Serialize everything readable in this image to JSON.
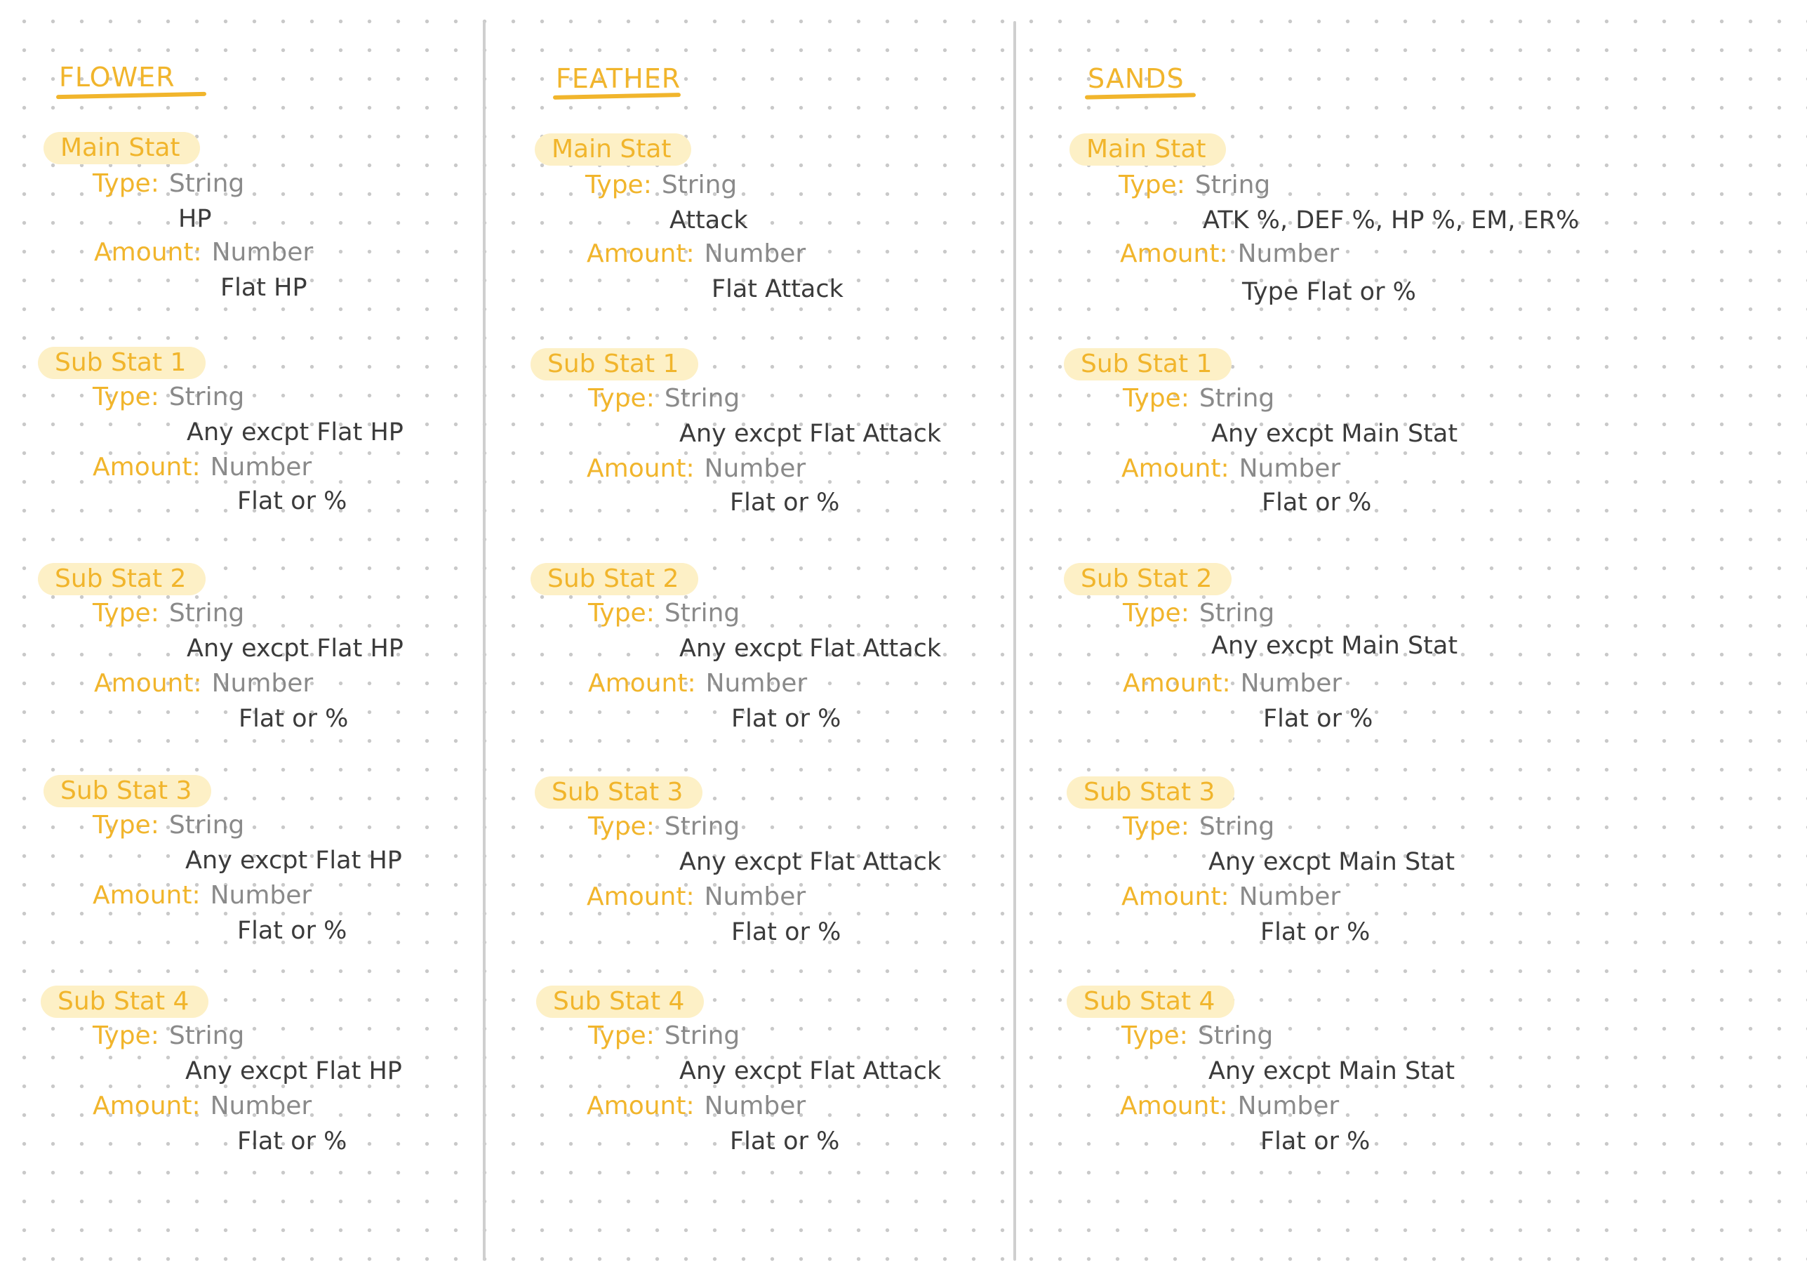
{
  "columns": [
    {
      "title": "FLOWER",
      "main_stat": {
        "label": "Main Stat",
        "type_key": "Type:",
        "type_value": "String",
        "type_detail": "HP",
        "amount_key": "Amount:",
        "amount_value": "Number",
        "amount_detail": "Flat HP"
      },
      "sub_stats": [
        {
          "label": "Sub Stat 1",
          "type_key": "Type:",
          "type_value": "String",
          "type_detail": "Any excpt Flat HP",
          "amount_key": "Amount:",
          "amount_value": "Number",
          "amount_detail": "Flat or %"
        },
        {
          "label": "Sub Stat 2",
          "type_key": "Type:",
          "type_value": "String",
          "type_detail": "Any excpt Flat HP",
          "amount_key": "Amount:",
          "amount_value": "Number",
          "amount_detail": "Flat or %"
        },
        {
          "label": "Sub Stat 3",
          "type_key": "Type:",
          "type_value": "String",
          "type_detail": "Any excpt Flat HP",
          "amount_key": "Amount:",
          "amount_value": "Number",
          "amount_detail": "Flat or %"
        },
        {
          "label": "Sub Stat 4",
          "type_key": "Type:",
          "type_value": "String",
          "type_detail": "Any excpt Flat HP",
          "amount_key": "Amount:",
          "amount_value": "Number",
          "amount_detail": "Flat or %"
        }
      ]
    },
    {
      "title": "FEATHER",
      "main_stat": {
        "label": "Main Stat",
        "type_key": "Type:",
        "type_value": "String",
        "type_detail": "Attack",
        "amount_key": "Amount:",
        "amount_value": "Number",
        "amount_detail": "Flat Attack"
      },
      "sub_stats": [
        {
          "label": "Sub Stat 1",
          "type_key": "Type:",
          "type_value": "String",
          "type_detail": "Any excpt Flat Attack",
          "amount_key": "Amount:",
          "amount_value": "Number",
          "amount_detail": "Flat or %"
        },
        {
          "label": "Sub Stat 2",
          "type_key": "Type:",
          "type_value": "String",
          "type_detail": "Any excpt Flat Attack",
          "amount_key": "Amount:",
          "amount_value": "Number",
          "amount_detail": "Flat or %"
        },
        {
          "label": "Sub Stat 3",
          "type_key": "Type:",
          "type_value": "String",
          "type_detail": "Any excpt Flat Attack",
          "amount_key": "Amount:",
          "amount_value": "Number",
          "amount_detail": "Flat or %"
        },
        {
          "label": "Sub Stat 4",
          "type_key": "Type:",
          "type_value": "String",
          "type_detail": "Any excpt Flat Attack",
          "amount_key": "Amount:",
          "amount_value": "Number",
          "amount_detail": "Flat or %"
        }
      ]
    },
    {
      "title": "SANDS",
      "main_stat": {
        "label": "Main Stat",
        "type_key": "Type:",
        "type_value": "String",
        "type_detail": "ATK %, DEF %, HP %, EM, ER%",
        "amount_key": "Amount:",
        "amount_value": "Number",
        "amount_detail": "Type Flat or %"
      },
      "sub_stats": [
        {
          "label": "Sub Stat 1",
          "type_key": "Type:",
          "type_value": "String",
          "type_detail": "Any excpt Main Stat",
          "amount_key": "Amount:",
          "amount_value": "Number",
          "amount_detail": "Flat or %"
        },
        {
          "label": "Sub Stat 2",
          "type_key": "Type:",
          "type_value": "String",
          "type_detail": "Any excpt Main Stat",
          "amount_key": "Amount:",
          "amount_value": "Number",
          "amount_detail": "Flat or %"
        },
        {
          "label": "Sub Stat 3",
          "type_key": "Type:",
          "type_value": "String",
          "type_detail": "Any excpt Main Stat",
          "amount_key": "Amount:",
          "amount_value": "Number",
          "amount_detail": "Flat or %"
        },
        {
          "label": "Sub Stat 4",
          "type_key": "Type:",
          "type_value": "String",
          "type_detail": "Any excpt Main Stat",
          "amount_key": "Amount:",
          "amount_value": "Number",
          "amount_detail": "Flat or %"
        }
      ]
    }
  ],
  "colors": {
    "accent": "#f1b52c",
    "highlight": "#fdf0c6",
    "muted_text": "#8a8a8a",
    "ink": "#3b3b3b",
    "divider": "#cfcfcf"
  }
}
